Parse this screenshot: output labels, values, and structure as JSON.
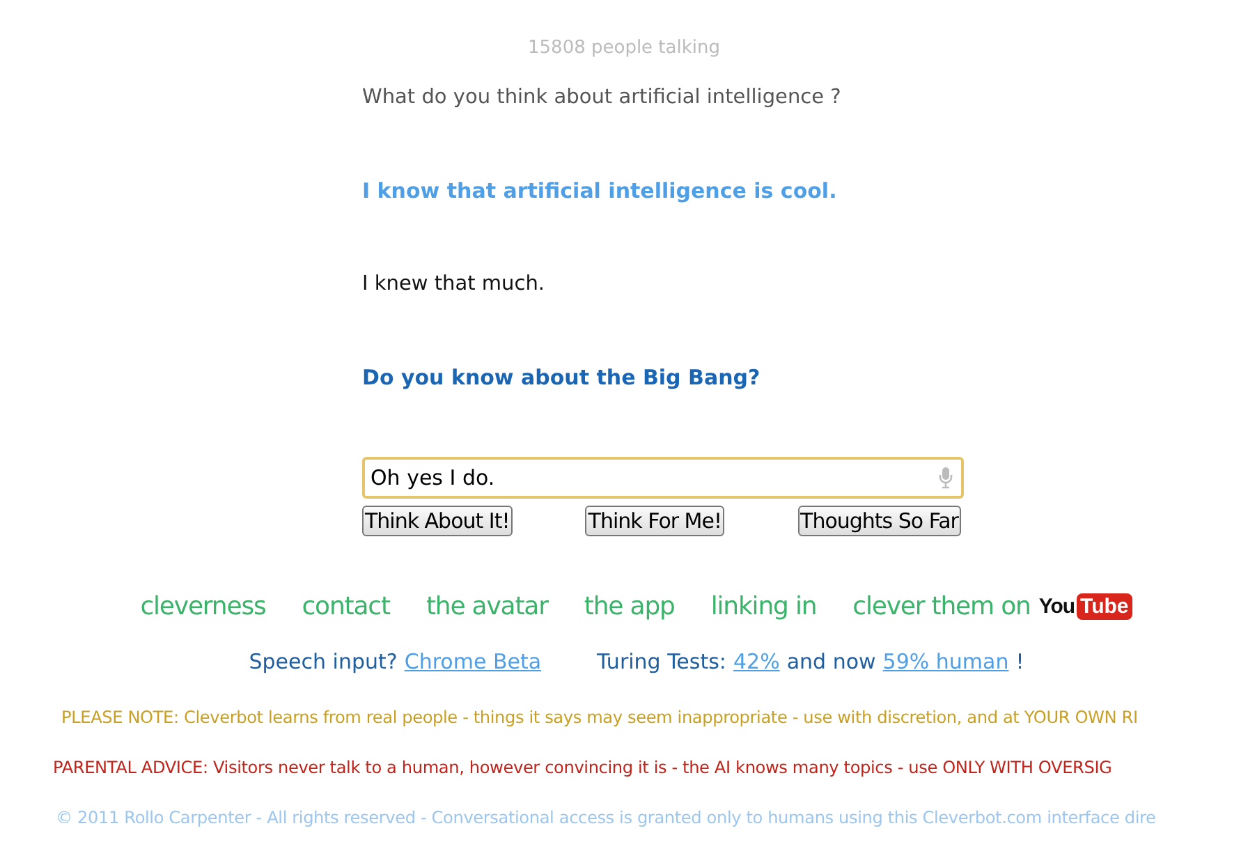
{
  "people_count": "15808 people talking",
  "conversation": [
    {
      "kind": "user",
      "faded": true,
      "text": "What do you think about artificial intelligence ?"
    },
    {
      "kind": "bot",
      "faded": true,
      "text": "I know that artificial intelligence is cool."
    },
    {
      "kind": "user",
      "faded": false,
      "text": "I knew that much."
    },
    {
      "kind": "bot",
      "faded": false,
      "text": "Do you know about the Big Bang?"
    }
  ],
  "input": {
    "value": "Oh yes I do."
  },
  "buttons": [
    "Think About It!",
    "Think For Me!",
    "Thoughts So Far"
  ],
  "nav_links": [
    "cleverness",
    "contact",
    "the avatar",
    "the app",
    "linking in",
    "clever them on"
  ],
  "youtube_logo": {
    "left": "You",
    "right": "Tube"
  },
  "speech": {
    "label": "Speech input?",
    "link": "Chrome Beta"
  },
  "turing": {
    "label": "Turing Tests:",
    "link_1": "42%",
    "middle": "and now",
    "link_2": "59% human",
    "end": "!"
  },
  "notices": [
    {
      "kind": "note",
      "text": "PLEASE NOTE: Cleverbot learns from real people - things it says may seem inappropriate - use with discretion, and at YOUR OWN RI"
    },
    {
      "kind": "parental",
      "text": "PARENTAL ADVICE: Visitors never talk to a human, however convincing it is - the AI knows many topics - use ONLY WITH OVERSIG"
    },
    {
      "kind": "copyright",
      "text": "© 2011 Rollo Carpenter - All rights reserved - Conversational access is granted only to humans using this Cleverbot.com interface dire"
    }
  ]
}
